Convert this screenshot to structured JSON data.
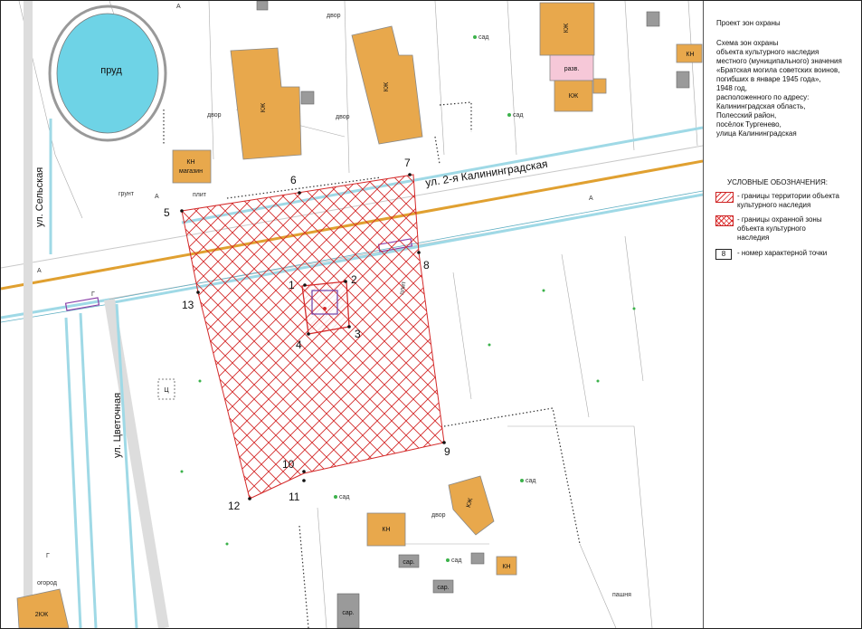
{
  "map": {
    "streets": {
      "main": "ул. 2-я Калининградская",
      "selskaya": "ул. Сельская",
      "tsvetochnaya": "ул. Цветочная"
    },
    "pond": "пруд",
    "buildings": {
      "kzh": "КЖ",
      "kn": "КН",
      "kn_shop": "КН",
      "shop": "магазин",
      "razv": "разв.",
      "sar": "сар.",
      "zh": "2КЖ",
      "ts": "Ц"
    },
    "labels": {
      "dvor": "двор",
      "sad": "сад",
      "grunt": "грунт",
      "plit": "плит",
      "ogorod": "огород",
      "pashnya": "пашня",
      "a": "А",
      "g": "Г"
    },
    "points": [
      {
        "id": "p1",
        "label": "1"
      },
      {
        "id": "p2",
        "label": "2"
      },
      {
        "id": "p3",
        "label": "3"
      },
      {
        "id": "p4",
        "label": "4"
      },
      {
        "id": "p5",
        "label": "5"
      },
      {
        "id": "p6",
        "label": "6"
      },
      {
        "id": "p7",
        "label": "7"
      },
      {
        "id": "p8",
        "label": "8"
      },
      {
        "id": "p9",
        "label": "9"
      },
      {
        "id": "p10",
        "label": "10"
      },
      {
        "id": "p11",
        "label": "11"
      },
      {
        "id": "p12",
        "label": "12"
      },
      {
        "id": "p13",
        "label": "13"
      }
    ],
    "colors": {
      "building": "#e8a84c",
      "road_axis": "#e0a030",
      "zone": "#d42a2a",
      "water": "#6ed3e6",
      "canal": "#9fd9e6",
      "razv": "#f6c8d8",
      "shed": "#9a9a9a"
    }
  },
  "panel": {
    "title": "Проект зон охраны",
    "description": "Схема зон охраны\nобъекта культурного наследия\nместного (муниципального) значения\n«Братская могила советских воинов,\nпогибших в январе 1945 года»,\n1948 год,\nрасположенного по адресу:\nКалининградская область,\nПолесский район,\nпосёлок Тургенево,\nулица Калининградская",
    "legend_title": "УСЛОВНЫЕ ОБОЗНАЧЕНИЯ:",
    "legend": [
      {
        "text": "- границы территории объекта\nкультурного наследия"
      },
      {
        "text": "- границы охранной зоны\nобъекта культурного\nнаследия"
      },
      {
        "text": "- номер характерной точки",
        "sample": "8"
      }
    ]
  }
}
